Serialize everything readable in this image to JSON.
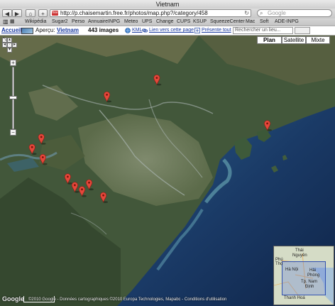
{
  "window": {
    "title": "Vietnam"
  },
  "toolbar": {
    "url": "http://p.chaisemartin.free.fr/photos/map.php?/category/458",
    "search_placeholder": "Google"
  },
  "bookmarks": [
    "Wikipédia",
    "Sugar2",
    "Perso",
    "AnnuaireINPG",
    "Meteo",
    "UPS",
    "Change",
    "CUPS",
    "KSUP",
    "SqueezeCenter",
    "Mac",
    "Soft",
    "ADE-INPG"
  ],
  "page": {
    "accueil": "Accueil",
    "apercu_label": "Aperçu:",
    "category": "Vietnam",
    "image_count": "443 images",
    "kml": "KML",
    "link_page": "Lien vers cette page",
    "present_all": "Présente tout",
    "search_place": "Rechercher un lieu..."
  },
  "map": {
    "types": [
      "Plan",
      "Satellite",
      "Mixte"
    ],
    "markers": [
      {
        "lat": 21.72,
        "lon": 105.7
      },
      {
        "lat": 21.52,
        "lon": 105.0
      },
      {
        "lat": 21.18,
        "lon": 107.25
      },
      {
        "lat": 21.02,
        "lon": 104.08
      },
      {
        "lat": 20.9,
        "lon": 103.95
      },
      {
        "lat": 20.78,
        "lon": 104.1
      },
      {
        "lat": 20.55,
        "lon": 104.45
      },
      {
        "lat": 20.45,
        "lon": 104.55
      },
      {
        "lat": 20.4,
        "lon": 104.65
      },
      {
        "lat": 20.48,
        "lon": 104.75
      },
      {
        "lat": 20.33,
        "lon": 104.95
      }
    ],
    "overview_labels": [
      "Thái",
      "Nguyên",
      "Phú",
      "Thọ",
      "Hà Nội",
      "Hải",
      "Phòng",
      "Tp. Nam",
      "Định",
      "Thanh Hoá"
    ],
    "attribution": "©2010 Google - Données cartographiques ©2010 Europa Technologies, Mapabc - Conditions d'utilisation",
    "google": "Google"
  },
  "colors": {
    "marker": "#e4473b",
    "link": "#1a3aa0",
    "sea": "#16325c",
    "land": "#4b5a3a"
  }
}
